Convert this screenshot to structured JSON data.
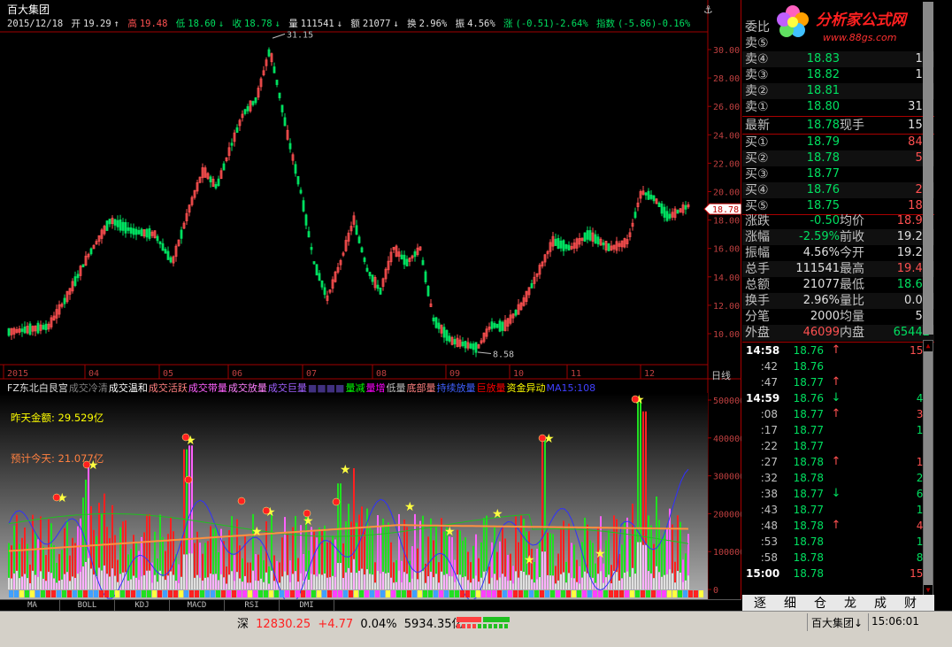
{
  "header": {
    "stock_name": "百大集团",
    "date": "2015/12/18",
    "open_label": "开",
    "open": "19.29",
    "high_label": "高",
    "high": "19.48",
    "low_label": "低",
    "low": "18.60",
    "close_label": "收",
    "close": "18.78",
    "volume_label": "量",
    "volume": "111541",
    "amount_label": "额",
    "amount": "21077",
    "turnover_label": "换",
    "turnover": "2.96%",
    "amplitude_label": "振",
    "amplitude": "4.56%",
    "change_label": "涨",
    "change": "(-0.51)-2.64%",
    "index_label": "指数",
    "index_change": "(-5.86)-0.16%"
  },
  "main_chart": {
    "y_ticks": [
      "30.00",
      "28.00",
      "26.00",
      "24.00",
      "22.00",
      "20.00",
      "18.00",
      "16.00",
      "14.00",
      "12.00",
      "10.00"
    ],
    "x_ticks": [
      "2015",
      "04",
      "05",
      "06",
      "07",
      "08",
      "09",
      "10",
      "11",
      "12"
    ],
    "max_marker": "31.15",
    "min_marker": "8.58",
    "current_price_tag": "18.78",
    "day_line_label": "日线"
  },
  "indicator": {
    "name": "FZ东北白艮宫",
    "labels": [
      {
        "text": "成交冷清",
        "color": "#808080"
      },
      {
        "text": "成交温和",
        "color": "#ffffff"
      },
      {
        "text": "成交活跃",
        "color": "#ff8080"
      },
      {
        "text": "成交带量",
        "color": "#ff60ff"
      },
      {
        "text": "成交放量",
        "color": "#ff80ff"
      },
      {
        "text": "成交巨量",
        "color": "#a060ff"
      },
      {
        "text": "■■■■",
        "color": "#403080"
      },
      {
        "text": "量减",
        "color": "#00ff00"
      },
      {
        "text": "量增",
        "color": "#ff00ff"
      },
      {
        "text": "低量",
        "color": "#c0c0c0"
      },
      {
        "text": "底部量",
        "color": "#ff8080"
      },
      {
        "text": "持续放量",
        "color": "#4060ff"
      },
      {
        "text": "巨放量",
        "color": "#ff0000"
      },
      {
        "text": "资金异动",
        "color": "#ffff00"
      },
      {
        "text": "MA15:108",
        "color": "#4040ff"
      }
    ],
    "yesterday_amount_label": "昨天金额: 29.529亿",
    "today_estimate_label": "预计今天: 21.077亿",
    "y_ticks": [
      "500000",
      "400000",
      "300000",
      "200000",
      "100000",
      "0"
    ]
  },
  "tabs": [
    "MA",
    "BOLL",
    "KDJ",
    "MACD",
    "RSI",
    "DMI"
  ],
  "order_book": {
    "weibi_label": "委比",
    "sell": [
      {
        "label": "卖⑤",
        "price": "",
        "vol": ""
      },
      {
        "label": "卖④",
        "price": "18.83",
        "vol": "19"
      },
      {
        "label": "卖③",
        "price": "18.82",
        "vol": "15"
      },
      {
        "label": "卖②",
        "price": "18.81",
        "vol": "3"
      },
      {
        "label": "卖①",
        "price": "18.80",
        "vol": "315"
      }
    ],
    "latest": {
      "label": "最新",
      "price": "18.78",
      "label2": "现手",
      "val2": "159"
    },
    "buy": [
      {
        "label": "买①",
        "price": "18.79",
        "vol": "841"
      },
      {
        "label": "买②",
        "price": "18.78",
        "vol": "50"
      },
      {
        "label": "买③",
        "price": "18.77",
        "vol": "8"
      },
      {
        "label": "买④",
        "price": "18.76",
        "vol": "27"
      },
      {
        "label": "买⑤",
        "price": "18.75",
        "vol": "180"
      }
    ]
  },
  "stats": [
    {
      "l1": "涨跌",
      "v1": "-0.50",
      "c1": "#00e060",
      "l2": "均价",
      "v2": "18.90",
      "c2": "#ff5050"
    },
    {
      "l1": "涨幅",
      "v1": "-2.59%",
      "c1": "#00e060",
      "l2": "前收",
      "v2": "19.29",
      "c2": "#e0e0e0"
    },
    {
      "l1": "振幅",
      "v1": "4.56%",
      "c1": "#e0e0e0",
      "l2": "今开",
      "v2": "19.29",
      "c2": "#e0e0e0"
    },
    {
      "l1": "总手",
      "v1": "111541",
      "c1": "#e0e0e0",
      "l2": "最高",
      "v2": "19.48",
      "c2": "#ff5050"
    },
    {
      "l1": "总额",
      "v1": "21077",
      "c1": "#e0e0e0",
      "l2": "最低",
      "v2": "18.60",
      "c2": "#00e060"
    },
    {
      "l1": "换手",
      "v1": "2.96%",
      "c1": "#e0e0e0",
      "l2": "量比",
      "v2": "0.01",
      "c2": "#e0e0e0"
    },
    {
      "l1": "分笔",
      "v1": "2000",
      "c1": "#e0e0e0",
      "l2": "均量",
      "v2": "56",
      "c2": "#e0e0e0"
    },
    {
      "l1": "外盘",
      "v1": "46099",
      "c1": "#ff5050",
      "l2": "内盘",
      "v2": "65442",
      "c2": "#00e060"
    }
  ],
  "trades": [
    {
      "time": "14:58",
      "price": "18.76",
      "dir": "up",
      "vol": "150",
      "bold": true
    },
    {
      "time": ":42",
      "price": "18.76",
      "dir": "",
      "vol": "8",
      "bold": false
    },
    {
      "time": ":47",
      "price": "18.77",
      "dir": "up",
      "vol": "7",
      "bold": false
    },
    {
      "time": "14:59",
      "price": "18.76",
      "dir": "down",
      "vol": "45",
      "bold": true
    },
    {
      "time": ":08",
      "price": "18.77",
      "dir": "up",
      "vol": "33",
      "bold": false
    },
    {
      "time": ":17",
      "price": "18.77",
      "dir": "",
      "vol": "17",
      "bold": false
    },
    {
      "time": ":22",
      "price": "18.77",
      "dir": "",
      "vol": "3",
      "bold": false
    },
    {
      "time": ":27",
      "price": "18.78",
      "dir": "up",
      "vol": "12",
      "bold": false
    },
    {
      "time": ":32",
      "price": "18.78",
      "dir": "",
      "vol": "22",
      "bold": false
    },
    {
      "time": ":38",
      "price": "18.77",
      "dir": "down",
      "vol": "63",
      "bold": false
    },
    {
      "time": ":43",
      "price": "18.77",
      "dir": "",
      "vol": "11",
      "bold": false
    },
    {
      "time": ":48",
      "price": "18.78",
      "dir": "up",
      "vol": "46",
      "bold": false
    },
    {
      "time": ":53",
      "price": "18.78",
      "dir": "",
      "vol": "15",
      "bold": false
    },
    {
      "time": ":58",
      "price": "18.78",
      "dir": "",
      "vol": "85",
      "bold": false
    },
    {
      "time": "15:00",
      "price": "18.78",
      "dir": "",
      "vol": "159",
      "bold": true
    }
  ],
  "side_tabs": [
    "逐",
    "细",
    "仓",
    "龙",
    "成",
    "财"
  ],
  "status": {
    "market": "深",
    "index_value": "12830.25",
    "index_change": "+4.77",
    "index_pct": "0.04%",
    "turnover": "5934.35亿",
    "stock_tag": "百大集团↓",
    "time": "15:06:01"
  },
  "logo": {
    "text": "分析家公式网",
    "url": "www.88gs.com"
  },
  "colors": {
    "up": "#ff5050",
    "down": "#00e060",
    "grid": "#a00000",
    "ma_blue": "#3030ff",
    "ma_green": "#20c020",
    "ma_orange": "#ff9040"
  }
}
